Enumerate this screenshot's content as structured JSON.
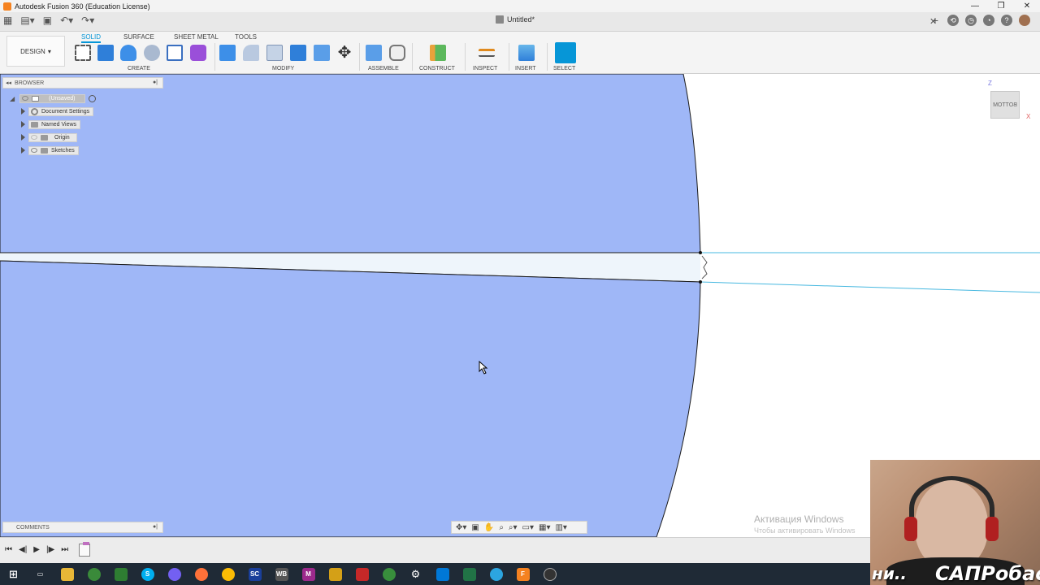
{
  "window": {
    "title": "Autodesk Fusion 360 (Education License)",
    "doc_tab": "Untitled*",
    "controls": [
      "—",
      "❐",
      "✕"
    ]
  },
  "toolbar": {
    "workspace": "DESIGN",
    "tabs": [
      "SOLID",
      "SURFACE",
      "SHEET METAL",
      "TOOLS"
    ],
    "active_tab": "SOLID",
    "groups": [
      "CREATE",
      "MODIFY",
      "ASSEMBLE",
      "CONSTRUCT",
      "INSPECT",
      "INSERT",
      "SELECT"
    ]
  },
  "browser": {
    "header": "BROWSER",
    "root": "(Unsaved)",
    "items": [
      "Document Settings",
      "Named Views",
      "Origin",
      "Sketches"
    ]
  },
  "viewcube": {
    "face": "BOTTOM",
    "axis_z": "Z",
    "axis_x": "X"
  },
  "comments": {
    "label": "COMMENTS"
  },
  "watermark": {
    "title": "Активация Windows",
    "subtitle": "Чтобы активировать Windows"
  },
  "webcam": {
    "caption_left": "ни..",
    "caption_right": "САПРобас"
  },
  "colors": {
    "accent": "#0696d7",
    "model_fill": "#9fb7f7",
    "sketch_line": "#47b8e0",
    "taskbar": "#1f2a36"
  }
}
